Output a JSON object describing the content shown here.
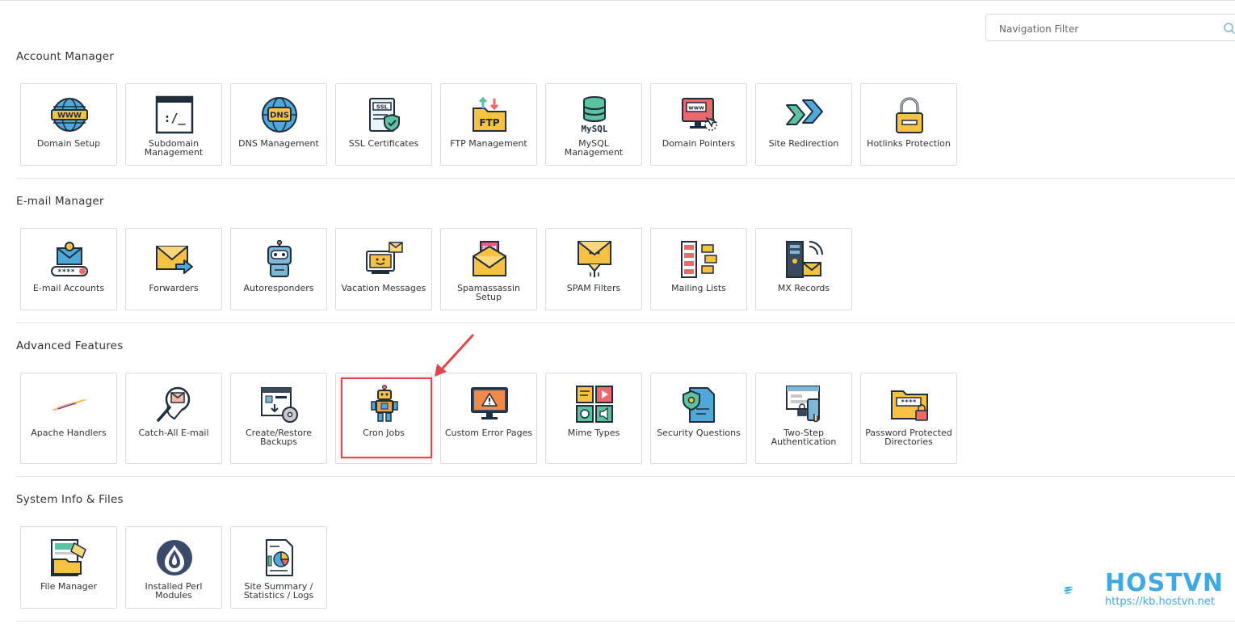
{
  "search": {
    "placeholder": "Navigation Filter"
  },
  "sections": [
    {
      "title": "Account Manager",
      "items": [
        "Domain Setup",
        "Subdomain Management",
        "DNS Management",
        "SSL Certificates",
        "FTP Management",
        "MySQL Management",
        "Domain Pointers",
        "Site Redirection",
        "Hotlinks Protection"
      ]
    },
    {
      "title": "E-mail Manager",
      "items": [
        "E-mail Accounts",
        "Forwarders",
        "Autoresponders",
        "Vacation Messages",
        "Spamassassin Setup",
        "SPAM Filters",
        "Mailing Lists",
        "MX Records"
      ]
    },
    {
      "title": "Advanced Features",
      "items": [
        "Apache Handlers",
        "Catch-All E-mail",
        "Create/Restore Backups",
        "Cron Jobs",
        "Custom Error Pages",
        "Mime Types",
        "Security Questions",
        "Two-Step Authentication",
        "Password Protected Directories"
      ]
    },
    {
      "title": "System Info & Files",
      "items": [
        "File Manager",
        "Installed Perl Modules",
        "Site Summary / Statistics / Logs"
      ]
    }
  ],
  "icon_text": {
    "www": "WWW",
    "console": ":/_",
    "dns": "DNS",
    "ssl": "SSL",
    "ftp": "FTP",
    "mysql": "MySQL",
    "pointer_www": "www",
    "spam": "SPAM",
    "mask": "****"
  },
  "watermark": {
    "brand": "HOSTVN",
    "url": "https://kb.hostvn.net"
  },
  "colors": {
    "accent": "#3fa9e0",
    "highlight": "#e0474c"
  }
}
